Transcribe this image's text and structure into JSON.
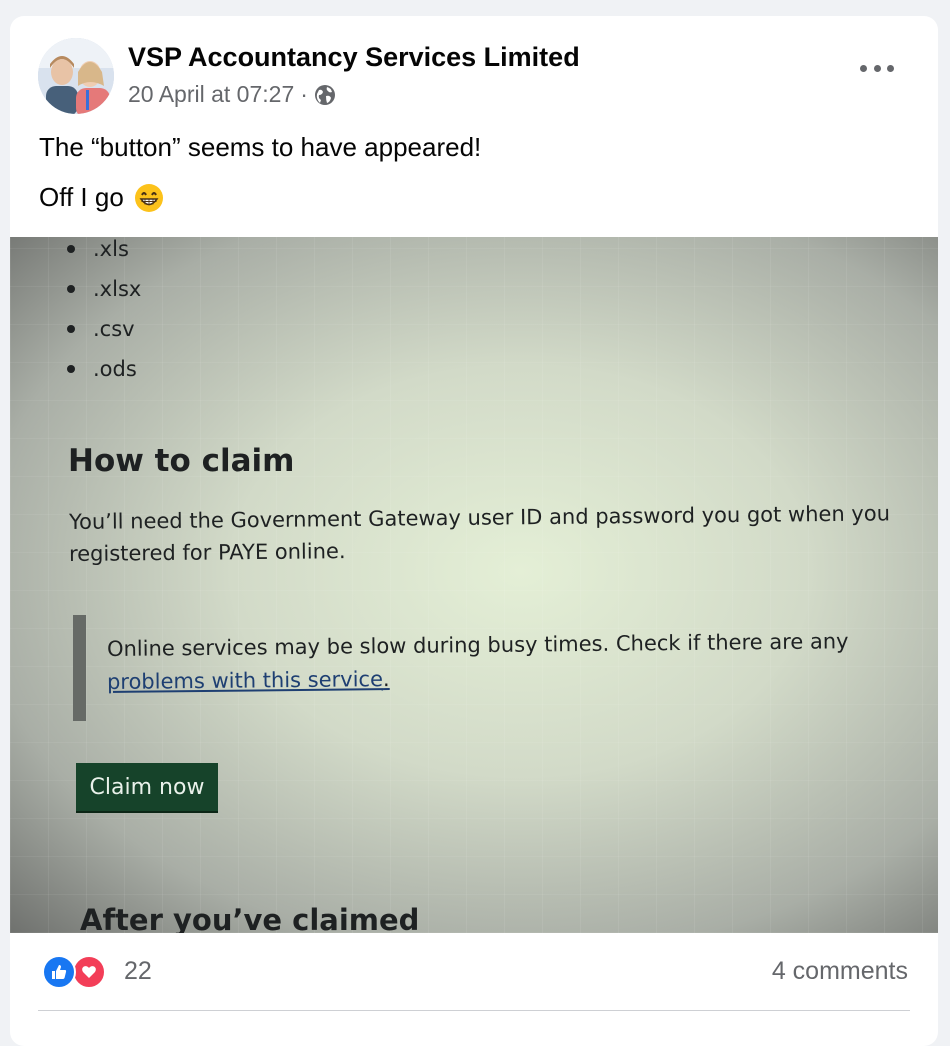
{
  "post": {
    "author": "VSP Accountancy Services Limited",
    "timestamp": "20 April at 07:27",
    "separator": "·",
    "privacy_icon": "globe-icon",
    "more_icon": "more-options-icon",
    "text_line1": "The “button” seems to have appeared!",
    "text_line2": "Off I go",
    "emoji": "grinning-face-emoji"
  },
  "photo": {
    "bullets": [
      ".xls",
      ".xlsx",
      ".csv",
      ".ods"
    ],
    "heading": "How to claim",
    "paragraph_line1": "You’ll need the Government Gateway user ID and password you got when you",
    "paragraph_line2": "registered for PAYE online.",
    "inset_text": "Online services may be slow during busy times. Check if there are any",
    "inset_link": "problems with this service",
    "inset_link_suffix": ".",
    "button_label": "Claim now",
    "next_heading": "After you’ve claimed"
  },
  "footer": {
    "reaction_icons": [
      "like-icon",
      "love-icon"
    ],
    "reaction_count": "22",
    "comments": "4 comments"
  },
  "colors": {
    "like": "#1877f2",
    "love": "#f33e58",
    "claim_button": "#16432a",
    "link": "#1e3f72"
  }
}
